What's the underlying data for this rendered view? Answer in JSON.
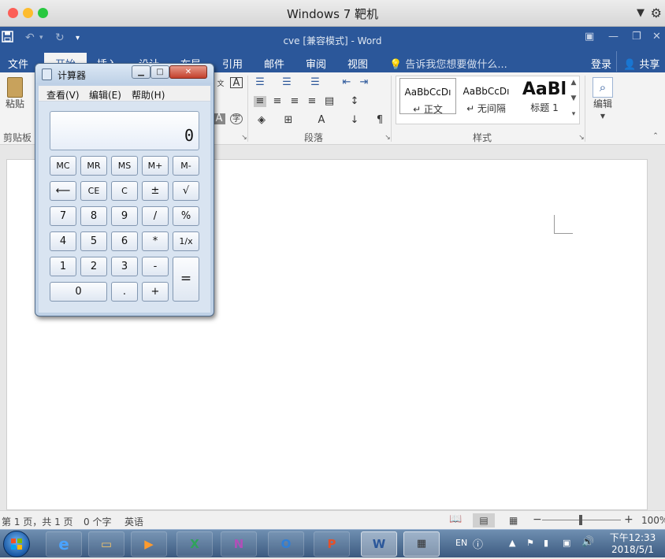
{
  "mac": {
    "title": "Windows 7 靶机",
    "menu_icon": "▼"
  },
  "word": {
    "doc_title": "cve [兼容模式] - Word",
    "tabs": [
      "文件",
      "开始",
      "插入",
      "设计",
      "布局",
      "引用",
      "邮件",
      "审阅",
      "视图"
    ],
    "tell_me": "告诉我您想要做什么...",
    "login": "登录",
    "share": "共享",
    "ribbon": {
      "clipboard_label": "剪贴板",
      "paste_label": "粘贴",
      "paragraph_label": "段落",
      "styles_label": "样式",
      "edit_label": "编辑",
      "font_char_label": "字",
      "styles": [
        {
          "sample": "AaBbCcDı",
          "name": "↵ 正文"
        },
        {
          "sample": "AaBbCcDı",
          "name": "↵ 无间隔"
        },
        {
          "sample": "AaBl",
          "name": "标题 1"
        }
      ]
    },
    "status": {
      "page": "第 1 页，共 1 页",
      "words": "0 个字",
      "lang": "英语",
      "zoom": "100%"
    }
  },
  "calc": {
    "title": "计算器",
    "menu": [
      "查看(V)",
      "编辑(E)",
      "帮助(H)"
    ],
    "display": "0",
    "keys": {
      "mc": "MC",
      "mr": "MR",
      "ms": "MS",
      "mplus": "M+",
      "mminus": "M-",
      "back": "⟵",
      "ce": "CE",
      "c": "C",
      "pm": "±",
      "sqrt": "√",
      "k7": "7",
      "k8": "8",
      "k9": "9",
      "div": "/",
      "pct": "%",
      "k4": "4",
      "k5": "5",
      "k6": "6",
      "mul": "*",
      "inv": "1/x",
      "k1": "1",
      "k2": "2",
      "k3": "3",
      "sub": "-",
      "eq": "=",
      "k0": "0",
      "dot": ".",
      "add": "+"
    }
  },
  "taskbar": {
    "ime": "EN",
    "time": "下午12:33",
    "date": "2018/5/1"
  }
}
